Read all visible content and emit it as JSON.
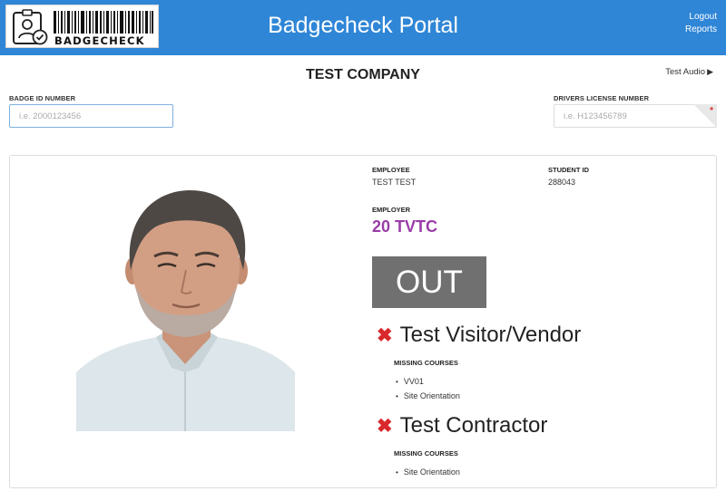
{
  "header": {
    "logo_text": "BADGECHECK",
    "title": "Badgecheck Portal",
    "logout_label": "Logout",
    "reports_label": "Reports"
  },
  "subheader": {
    "company": "TEST COMPANY",
    "test_audio_label": "Test Audio",
    "test_audio_icon": "play-triangle"
  },
  "form": {
    "badge_label": "BADGE ID NUMBER",
    "badge_placeholder": "i.e. 2000123456",
    "badge_value": "",
    "dl_label": "DRIVERS LICENSE NUMBER",
    "dl_placeholder": "i.e. H123456789",
    "dl_value": "",
    "required_mark": "*"
  },
  "employee": {
    "employee_label": "EMPLOYEE",
    "employee_name": "TEST TEST",
    "student_id_label": "STUDENT ID",
    "student_id": "288043",
    "employer_label": "EMPLOYER",
    "employer": "20 TVTC",
    "status": "OUT"
  },
  "requirements": [
    {
      "title": "Test Visitor/Vendor",
      "missing_label": "MISSING COURSES",
      "courses": [
        "VV01",
        "Site Orientation"
      ]
    },
    {
      "title": "Test Contractor",
      "missing_label": "MISSING COURSES",
      "courses": [
        "Site Orientation"
      ]
    }
  ],
  "icons": {
    "fail_mark": "✖",
    "bullet": "•"
  },
  "colors": {
    "header_bg": "#2f86d6",
    "employer_text": "#9a3da8",
    "status_bg": "#707070",
    "fail_icon": "#d9282b"
  }
}
